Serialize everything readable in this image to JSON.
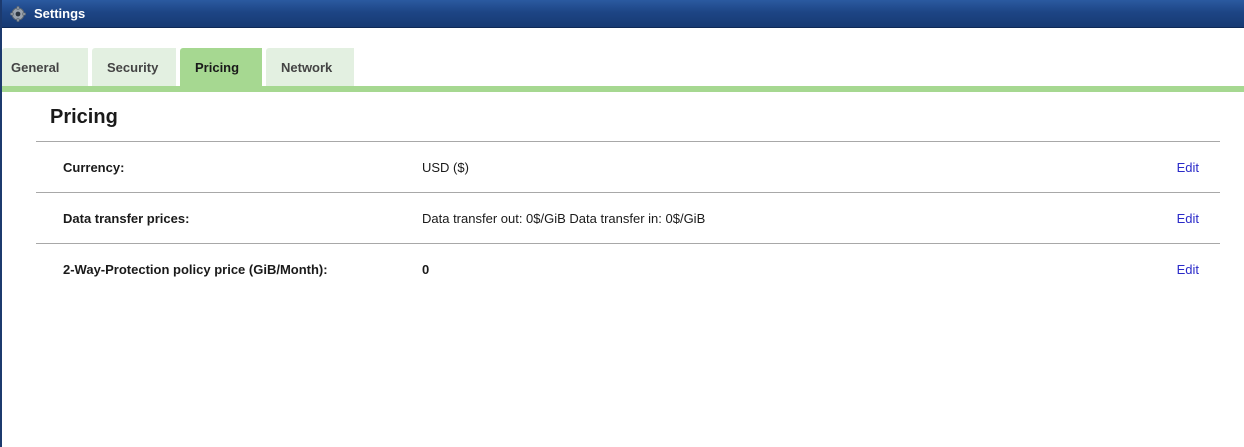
{
  "window": {
    "title": "Settings",
    "icon": "gear-icon"
  },
  "tabs": [
    {
      "label": "General",
      "active": false
    },
    {
      "label": "Security",
      "active": false
    },
    {
      "label": "Pricing",
      "active": true
    },
    {
      "label": "Network",
      "active": false
    }
  ],
  "pricing": {
    "heading": "Pricing",
    "rows": [
      {
        "label": "Currency:",
        "value": "USD ($)",
        "action": "Edit"
      },
      {
        "label": "Data transfer prices:",
        "value": "Data transfer out: 0$/GiB Data transfer in: 0$/GiB",
        "action": "Edit"
      },
      {
        "label": "2-Way-Protection policy price (GiB/Month):",
        "value": "0",
        "action": "Edit"
      }
    ]
  },
  "colors": {
    "titlebar": "#1d4585",
    "active_tab": "#a6d891",
    "inactive_tab": "#e3f0e1",
    "link": "#2a2ac8"
  }
}
